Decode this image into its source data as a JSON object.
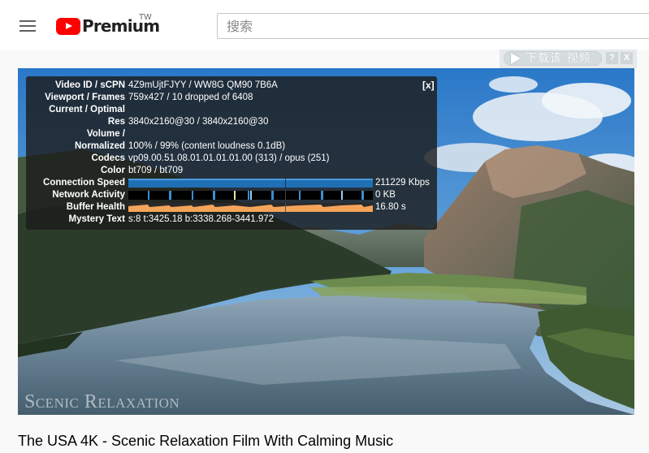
{
  "header": {
    "menu_icon": "hamburger-menu-icon",
    "logo_text": "Premium",
    "country_code": "TW",
    "search_placeholder": "搜索",
    "brand_red": "#ff0000"
  },
  "download_helper": {
    "button_label": "下载该 视频",
    "help_label": "?",
    "close_label": "X"
  },
  "player": {
    "watermark": "Scenic Relaxation",
    "stats": {
      "close_label": "[x]",
      "rows": [
        {
          "label": "Video ID / sCPN",
          "value": "4Z9mUjtFJYY / WW8G QM90 7B6A"
        },
        {
          "label": "Viewport / Frames",
          "value": "759x427 / 10 dropped of 6408"
        },
        {
          "label": "Current / Optimal",
          "value": ""
        },
        {
          "label": "Res",
          "value": "3840x2160@30 / 3840x2160@30"
        },
        {
          "label": "Volume /",
          "value": ""
        },
        {
          "label": "Normalized",
          "value": "100% / 99% (content loudness 0.1dB)"
        },
        {
          "label": "Codecs",
          "value": "vp09.00.51.08.01.01.01.01.00 (313) / opus (251)"
        },
        {
          "label": "Color",
          "value": "bt709 / bt709"
        },
        {
          "label": "Connection Speed",
          "value": "211229 Kbps"
        },
        {
          "label": "Network Activity",
          "value": "0 KB"
        },
        {
          "label": "Buffer Health",
          "value": "16.80 s"
        },
        {
          "label": "Mystery Text",
          "value": "s:8 t:3425.18 b:3338.268-3441.972"
        }
      ],
      "colors": {
        "connection": "#1f6fb5",
        "network": "#3c8fd0",
        "buffer": "#f4a45a"
      }
    }
  },
  "video": {
    "title": "The USA 4K - Scenic Relaxation Film With Calming Music"
  }
}
